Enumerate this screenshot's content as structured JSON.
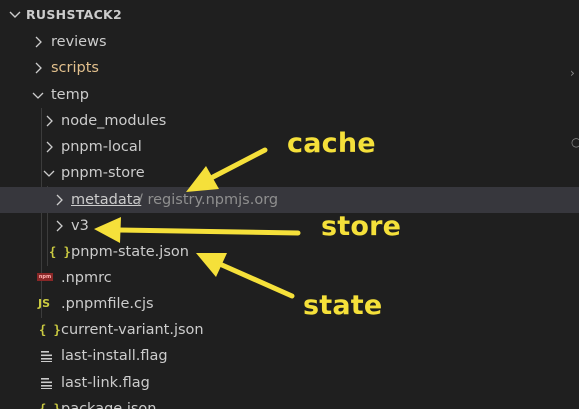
{
  "explorer": {
    "root_title": "RUSHSTACK2",
    "rows": [
      {
        "label": "reviews",
        "kind": "folder"
      },
      {
        "label": "scripts",
        "kind": "folder"
      },
      {
        "label": "temp",
        "kind": "folder-open"
      },
      {
        "label": "node_modules",
        "kind": "folder"
      },
      {
        "label": "pnpm-local",
        "kind": "folder"
      },
      {
        "label": "pnpm-store",
        "kind": "folder-open"
      },
      {
        "label": "metadata",
        "label_suffix": "/ registry.npmjs.org",
        "kind": "folder"
      },
      {
        "label": "v3",
        "kind": "folder"
      },
      {
        "label": "pnpm-state.json",
        "kind": "json"
      },
      {
        "label": ".npmrc",
        "kind": "npm"
      },
      {
        "label": ".pnpmfile.cjs",
        "kind": "js"
      },
      {
        "label": "current-variant.json",
        "kind": "json"
      },
      {
        "label": "last-install.flag",
        "kind": "flag"
      },
      {
        "label": "last-link.flag",
        "kind": "flag"
      },
      {
        "label": "package.json",
        "kind": "json"
      }
    ]
  },
  "icons": {
    "json": "{ }",
    "js": "JS",
    "npm": "npm"
  },
  "annotations": {
    "cache": "cache",
    "store": "store",
    "state": "state"
  },
  "colors": {
    "background": "#1f1f1f",
    "selected_row": "#37373d",
    "annotation": "#f5e03a",
    "scripts_label": "#e2c08d",
    "json_icon": "#cbcb41"
  }
}
